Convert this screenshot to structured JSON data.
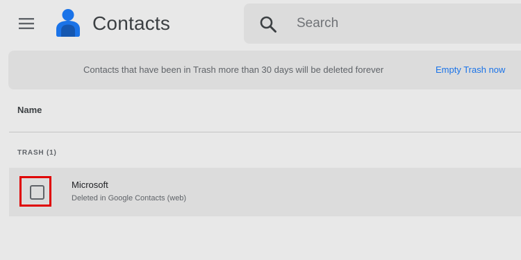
{
  "header": {
    "menu_icon": "hamburger-menu-icon",
    "logo_icon": "contacts-logo-icon",
    "title": "Contacts",
    "search": {
      "icon": "search-icon",
      "placeholder": "Search",
      "value": ""
    }
  },
  "banner": {
    "message": "Contacts that have been in Trash more than 30 days will be deleted forever",
    "action_label": "Empty Trash now"
  },
  "list": {
    "column_header": "Name",
    "section_label": "TRASH (1)",
    "rows": [
      {
        "name": "Microsoft",
        "subtitle": "Deleted in Google Contacts (web)",
        "checked": false
      }
    ]
  },
  "colors": {
    "accent": "#1a73e8",
    "highlight": "#e00000",
    "logo_blue": "#1a73e8",
    "logo_dark": "#1557b0"
  }
}
